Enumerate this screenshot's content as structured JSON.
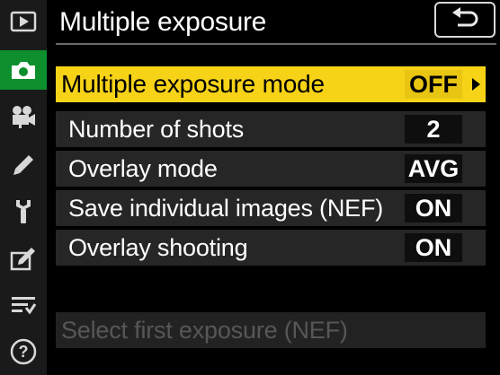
{
  "header": {
    "title": "Multiple exposure"
  },
  "sidebar": {
    "items": [
      {
        "icon": "playback-icon"
      },
      {
        "icon": "camera-icon",
        "active": true
      },
      {
        "icon": "movie-camera-icon"
      },
      {
        "icon": "pencil-icon"
      },
      {
        "icon": "wrench-icon"
      },
      {
        "icon": "retouch-icon"
      },
      {
        "icon": "my-menu-icon"
      },
      {
        "icon": "help-icon",
        "label": "?"
      }
    ]
  },
  "menu": {
    "items": [
      {
        "label": "Multiple exposure mode",
        "value": "OFF",
        "selected": true
      },
      {
        "label": "Number of shots",
        "value": "2"
      },
      {
        "label": "Overlay mode",
        "value": "AVG"
      },
      {
        "label": "Save individual images (NEF)",
        "value": "ON"
      },
      {
        "label": "Overlay shooting",
        "value": "ON"
      }
    ],
    "disabled_item": {
      "label": "Select first exposure (NEF)"
    }
  },
  "colors": {
    "highlight": "#f7d317",
    "active_tab": "#0d8f2e",
    "row_bg": "#262626",
    "disabled_text": "#575757"
  }
}
